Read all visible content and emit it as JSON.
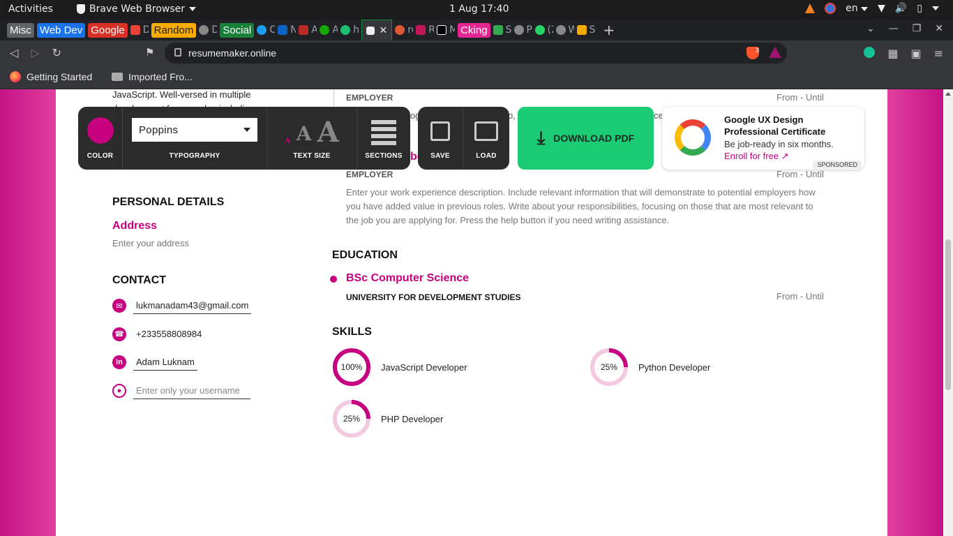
{
  "system": {
    "activities": "Activities",
    "app_name": "Brave Web Browser",
    "clock": "1 Aug  17:40",
    "lang": "en"
  },
  "tabs": {
    "groups": [
      {
        "label": "Misc",
        "color": "#5f6368"
      },
      {
        "label": "Web Dev",
        "color": "#1a73e8"
      },
      {
        "label": "Google",
        "color": "#d93025"
      },
      {
        "label": "Random",
        "color": "#f9ab00"
      },
      {
        "label": "Social",
        "color": "#188038"
      },
      {
        "label": "Cking",
        "color": "#e52592"
      }
    ],
    "mini": [
      "Dı",
      "Do",
      "Cł",
      "Ne",
      "Ac",
      "Ac",
      "ht",
      "re",
      "Re",
      "M",
      "Sa",
      "Pr",
      "(2",
      "W",
      "Sa"
    ]
  },
  "browser": {
    "url": "resumemaker.online",
    "shield_count": "3"
  },
  "bookmarks": {
    "getting_started": "Getting Started",
    "imported": "Imported Fro..."
  },
  "editor": {
    "color_label": "COLOR",
    "font_value": "Poppins",
    "typography_label": "TYPOGRAPHY",
    "text_size_label": "TEXT SIZE",
    "sections_label": "SECTIONS",
    "save_label": "SAVE",
    "load_label": "LOAD",
    "download_label": "DOWNLOAD PDF",
    "accent_color": "#c6007e"
  },
  "ad": {
    "title": "Google UX Design Professional Certificate",
    "body": "Be job-ready in six months.",
    "cta": "Enroll for free ↗",
    "badge": "SPONSORED"
  },
  "resume": {
    "summary_line1": "JavaScript. Well-versed in multiple",
    "summary_line2": "development frameworks, including",
    "employer1": "EMPLOYER",
    "range1": "From - Until",
    "job1_fragment_a": "og",
    "job1_fragment_b": "o, y",
    "job1_fragment_c": "ce",
    "job2_title_fragment": "be",
    "employer2": "EMPLOYER",
    "range2": "From - Until",
    "job2_desc": "Enter your work experience description. Include relevant information that will demonstrate to potential employers how you have added value in previous roles. Write about your responsibilities, focusing on those that are most relevant to the job you are applying for. Press the help button if you need writing assistance.",
    "personal_details": "PERSONAL DETAILS",
    "address_label": "Address",
    "address_placeholder": "Enter your address",
    "contact": "CONTACT",
    "email": "lukmanadam43@gmail.com",
    "phone": "+233558808984",
    "linkedin": "Adam Luknam",
    "github_placeholder": "Enter only your username",
    "education": "EDUCATION",
    "degree": "BSc Computer Science",
    "school": "UNIVERSITY FOR DEVELOPMENT STUDIES",
    "edu_range": "From - Until",
    "skills_title": "SKILLS",
    "skills": [
      {
        "pct_label": "100%",
        "pct": 100,
        "name": "JavaScript Developer"
      },
      {
        "pct_label": "25%",
        "pct": 25,
        "name": "Python Developer"
      },
      {
        "pct_label": "25%",
        "pct": 25,
        "name": "PHP Developer"
      }
    ]
  }
}
